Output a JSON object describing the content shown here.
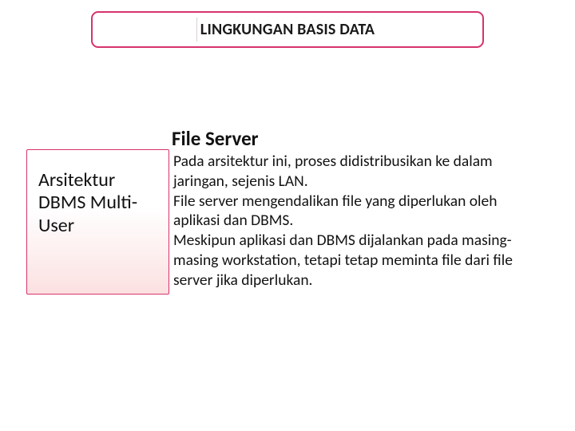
{
  "title": "LINGKUNGAN BASIS DATA",
  "heading": "File Server",
  "side_label": "Arsitektur DBMS Multi-User",
  "body": "Pada arsitektur ini, proses didistribusikan ke dalam jaringan, sejenis LAN.\n File server mengendalikan file yang diperlukan oleh aplikasi dan DBMS.\nMeskipun aplikasi dan DBMS dijalankan pada masing-masing workstation, tetapi tetap meminta file dari file server jika diperlukan."
}
